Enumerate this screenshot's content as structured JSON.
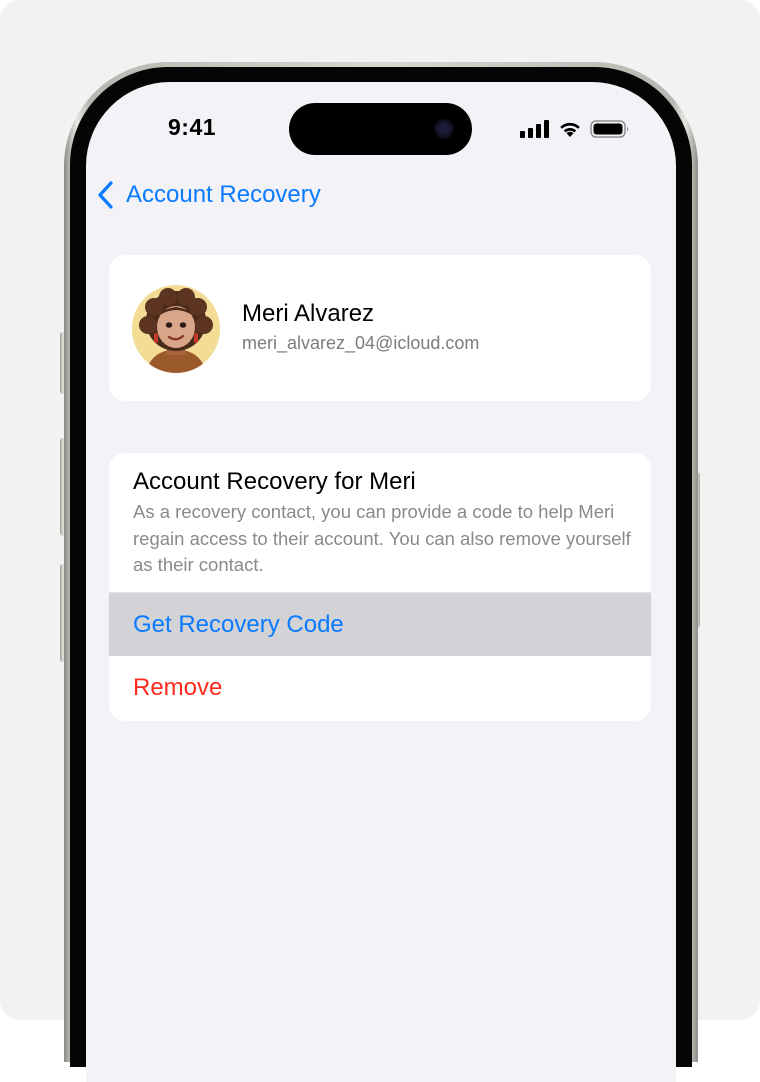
{
  "status_bar": {
    "time": "9:41",
    "icons": [
      "cellular-signal-icon",
      "wifi-icon",
      "battery-icon"
    ]
  },
  "nav": {
    "back_icon": "chevron-left-icon",
    "title": "Account Recovery"
  },
  "profile": {
    "avatar": "memoji-avatar",
    "name": "Meri Alvarez",
    "email": "meri_alvarez_04@icloud.com"
  },
  "recovery": {
    "title": "Account Recovery for Meri",
    "description": "As a recovery contact, you can provide a code to help Meri regain access to their account. You can also remove yourself as their contact.",
    "actions": [
      {
        "label": "Get Recovery Code",
        "state": "pressed"
      },
      {
        "label": "Remove",
        "style": "destructive"
      }
    ]
  },
  "colors": {
    "accent": "#0a7aff",
    "destructive": "#ff2a1e",
    "background": "#f2f2f7",
    "highlight": "#d2d2d7"
  }
}
